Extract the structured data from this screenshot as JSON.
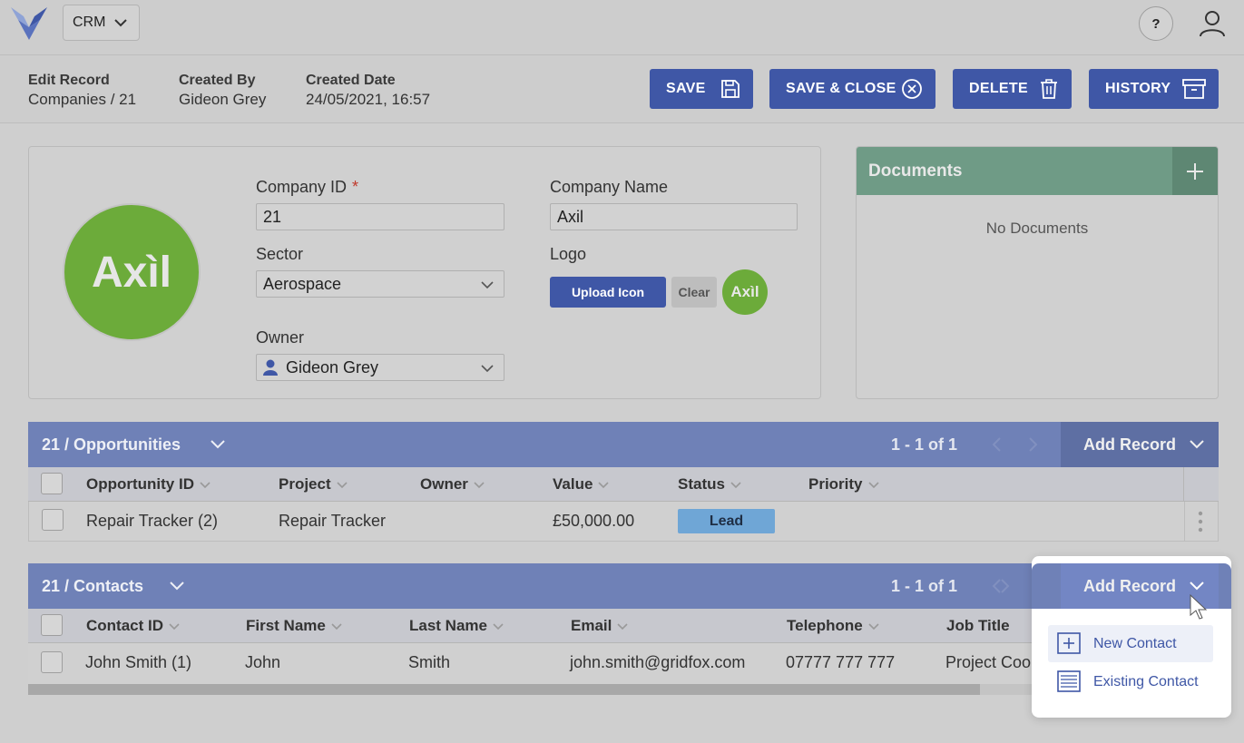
{
  "header": {
    "app_select": "CRM",
    "help_label": "?"
  },
  "record_info": {
    "edit_label": "Edit Record",
    "edit_value": "Companies / 21",
    "created_by_label": "Created By",
    "created_by_value": "Gideon Grey",
    "created_date_label": "Created Date",
    "created_date_value": "24/05/2021, 16:57"
  },
  "toolbar": {
    "save": "SAVE",
    "save_close": "SAVE & CLOSE",
    "delete": "DELETE",
    "history": "HISTORY"
  },
  "form": {
    "company_id_label": "Company ID",
    "required_mark": "*",
    "company_id_value": "21",
    "company_name_label": "Company Name",
    "company_name_value": "Axil",
    "sector_label": "Sector",
    "sector_value": "Aerospace",
    "logo_label": "Logo",
    "upload_label": "Upload Icon",
    "clear_label": "Clear",
    "owner_label": "Owner",
    "owner_value": "Gideon Grey",
    "logo_text": "Axìl"
  },
  "documents": {
    "title": "Documents",
    "empty_text": "No Documents"
  },
  "opportunities": {
    "title": "21 / Opportunities",
    "pager": "1 - 1 of 1",
    "add_record": "Add Record",
    "columns": [
      "Opportunity ID",
      "Project",
      "Owner",
      "Value",
      "Status",
      "Priority"
    ],
    "rows": [
      {
        "opportunity_id": "Repair Tracker (2)",
        "project": "Repair Tracker",
        "owner": "",
        "value": "£50,000.00",
        "status": "Lead",
        "priority": ""
      }
    ]
  },
  "contacts": {
    "title": "21 / Contacts",
    "pager": "1 - 1 of 1",
    "add_record": "Add Record",
    "columns": [
      "Contact ID",
      "First Name",
      "Last Name",
      "Email",
      "Telephone",
      "Job Title"
    ],
    "rows": [
      {
        "contact_id": "John Smith (1)",
        "first_name": "John",
        "last_name": "Smith",
        "email": "john.smith@gridfox.com",
        "telephone": "07777 777 777",
        "job_title": "Project Coor"
      }
    ]
  },
  "add_record_menu": {
    "items": [
      "New Contact",
      "Existing Contact"
    ]
  },
  "colors": {
    "primary": "#3f57a6",
    "panel_header": "#6f81b7",
    "documents_header": "#6f9b86",
    "logo_green": "#6cab3a",
    "status_lead": "#6fa6d6"
  }
}
